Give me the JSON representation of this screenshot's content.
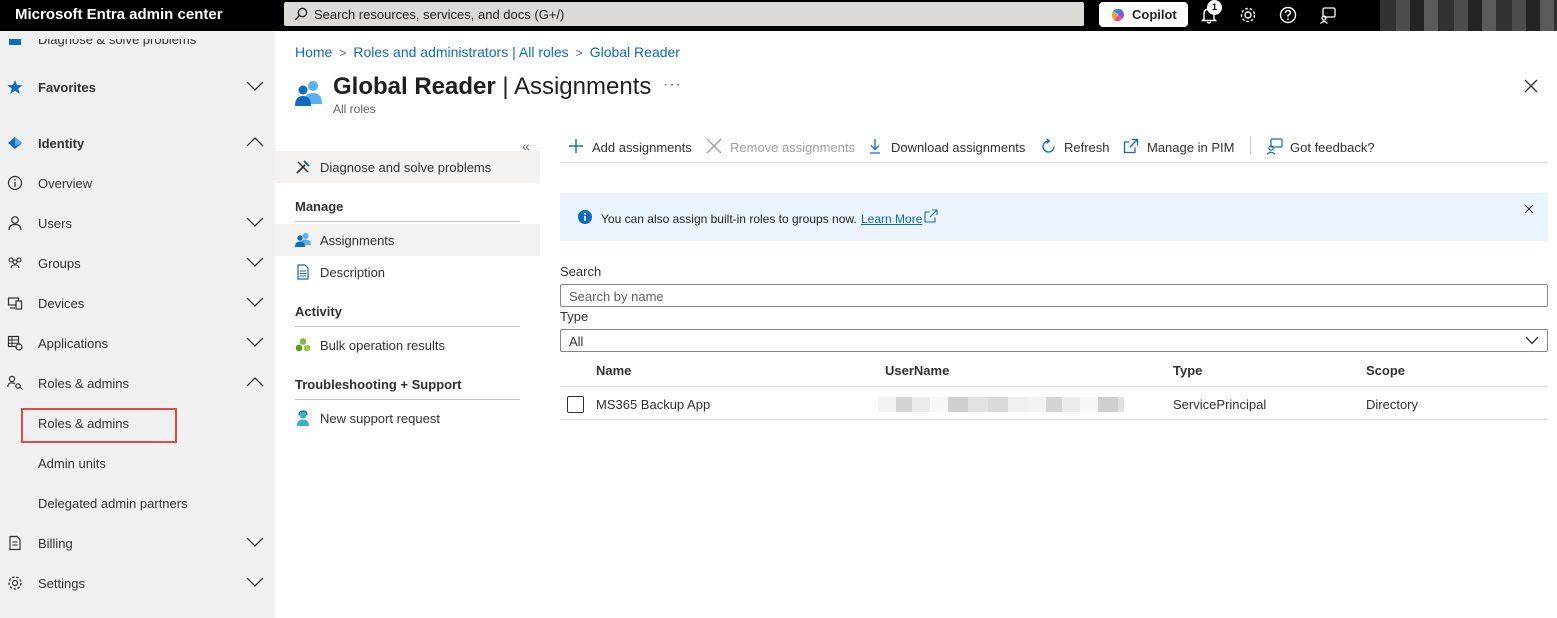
{
  "topbar": {
    "app_title": "Microsoft Entra admin center",
    "search_placeholder": "Search resources, services, and docs (G+/)",
    "copilot_label": "Copilot",
    "notification_count": "1",
    "icons": [
      "bell-icon",
      "gear-icon",
      "help-icon",
      "feedback-icon"
    ]
  },
  "sidebar": {
    "partial_top_label": "Diagnose & solve problems",
    "items": [
      {
        "label": "Favorites",
        "icon": "star-icon",
        "expanded": false
      },
      {
        "label": "Identity",
        "icon": "identity-diamond-icon",
        "expanded": true
      },
      {
        "label": "Overview",
        "icon": "info-circle-icon"
      },
      {
        "label": "Users",
        "icon": "person-icon",
        "expanded": false
      },
      {
        "label": "Groups",
        "icon": "people-icon",
        "expanded": false
      },
      {
        "label": "Devices",
        "icon": "devices-icon",
        "expanded": false
      },
      {
        "label": "Applications",
        "icon": "apps-grid-icon",
        "expanded": false
      },
      {
        "label": "Roles & admins",
        "icon": "person-key-icon",
        "expanded": true
      },
      {
        "label": "Billing",
        "icon": "document-icon",
        "expanded": false
      },
      {
        "label": "Settings",
        "icon": "gear-icon",
        "expanded": false
      }
    ],
    "sub_items": [
      "Roles & admins",
      "Admin units",
      "Delegated admin partners"
    ]
  },
  "breadcrumb": [
    "Home",
    "Roles and administrators | All roles",
    "Global Reader"
  ],
  "page": {
    "title_bold": "Global Reader",
    "title_rest": " | Assignments",
    "subtitle": "All roles",
    "more": "···"
  },
  "blade_menu": {
    "collapse": "«",
    "top_item": "Diagnose and solve problems",
    "sections": [
      {
        "heading": "Manage",
        "items": [
          "Assignments",
          "Description"
        ]
      },
      {
        "heading": "Activity",
        "items": [
          "Bulk operation results"
        ]
      },
      {
        "heading": "Troubleshooting + Support",
        "items": [
          "New support request"
        ]
      }
    ]
  },
  "toolbar": {
    "add": "Add assignments",
    "remove": "Remove assignments",
    "download": "Download assignments",
    "refresh": "Refresh",
    "pim": "Manage in PIM",
    "feedback": "Got feedback?"
  },
  "banner": {
    "text": "You can also assign built-in roles to groups now.",
    "link": "Learn More"
  },
  "filters": {
    "search_label": "Search",
    "search_placeholder": "Search by name",
    "type_label": "Type",
    "type_value": "All"
  },
  "table": {
    "columns": [
      "Name",
      "UserName",
      "Type",
      "Scope"
    ],
    "rows": [
      {
        "name": "MS365 Backup App",
        "username": "",
        "type": "ServicePrincipal",
        "scope": "Directory"
      }
    ]
  },
  "colors": {
    "accent": "#0f6cbd",
    "highlight": "#e04a4a",
    "banner_bg": "#ebf3fc"
  }
}
